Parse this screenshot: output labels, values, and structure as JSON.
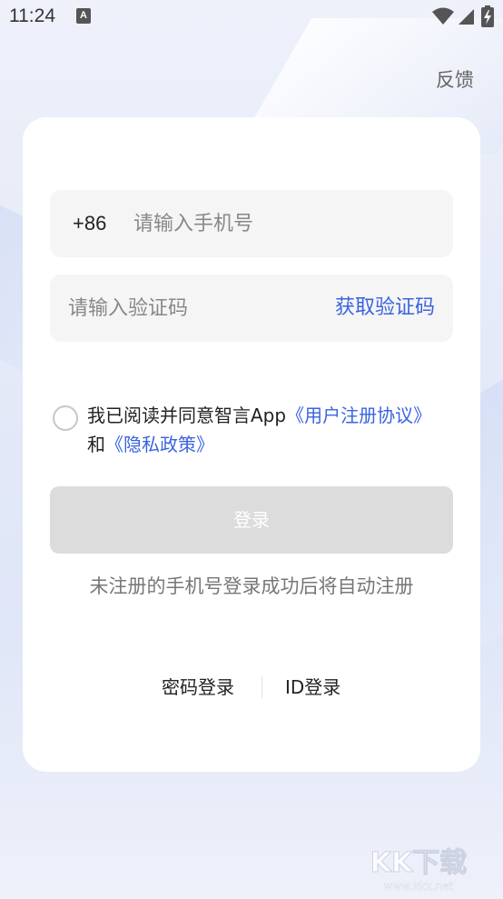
{
  "status_bar": {
    "time": "11:24",
    "notification_badge": "A"
  },
  "header": {
    "feedback_label": "反馈"
  },
  "login_form": {
    "country_code": "+86",
    "phone_placeholder": "请输入手机号",
    "code_placeholder": "请输入验证码",
    "get_code_label": "获取验证码",
    "agreement": {
      "prefix": "我已阅读并同意智言App",
      "user_agreement_link": "《用户注册协议》",
      "conjunction": "和",
      "privacy_link": "《隐私政策》"
    },
    "login_button_label": "登录",
    "hint": "未注册的手机号登录成功后将自动注册"
  },
  "alt_login": {
    "password_login_label": "密码登录",
    "id_login_label": "ID登录"
  },
  "watermark": {
    "logo_text": "KK下载",
    "url": "www.kkx.net"
  },
  "colors": {
    "accent": "#3a63e0",
    "button_disabled": "#dcdcdc",
    "field_bg": "#f5f5f5"
  }
}
